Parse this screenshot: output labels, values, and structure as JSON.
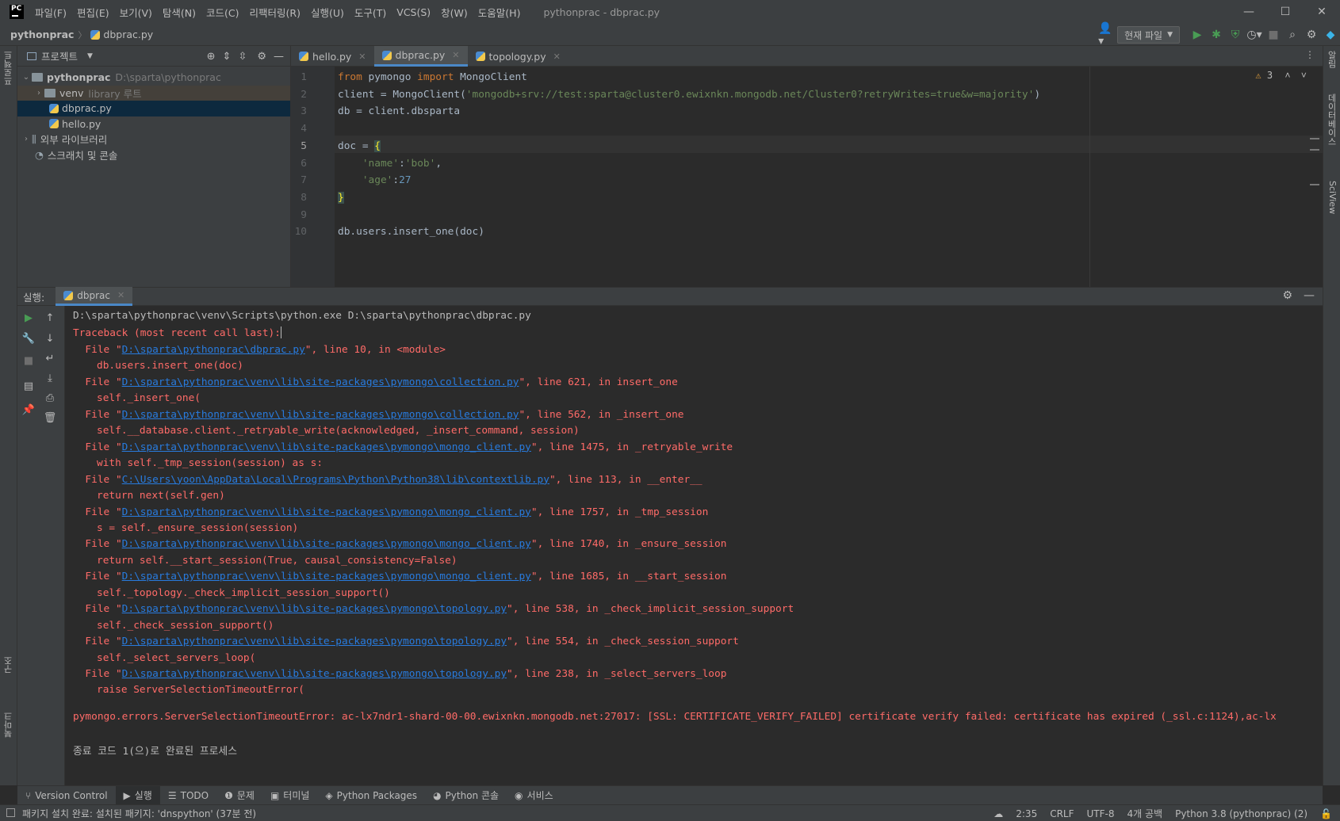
{
  "menu": [
    "파일(F)",
    "편집(E)",
    "보기(V)",
    "탐색(N)",
    "코드(C)",
    "리팩터링(R)",
    "실행(U)",
    "도구(T)",
    "VCS(S)",
    "창(W)",
    "도움말(H)"
  ],
  "window": {
    "title": "pythonprac - dbprac.py",
    "minimize": "—",
    "maximize": "☐",
    "close": "✕"
  },
  "breadcrumb": {
    "project": "pythonprac",
    "file": "dbprac.py"
  },
  "toolbar": {
    "run_config": "현재 파일"
  },
  "left_stripe": {
    "project": "프로젝트",
    "structure": "구조",
    "bookmarks": "북마크"
  },
  "right_stripe": {
    "notifications": "알림",
    "database": "데이터베이스",
    "sciview": "SciView"
  },
  "project_panel": {
    "title": "프로젝트",
    "tree": [
      {
        "label": "pythonprac",
        "sub": "D:\\sparta\\pythonprac"
      },
      {
        "label": "venv",
        "sub": "library 루트"
      },
      {
        "label": "dbprac.py"
      },
      {
        "label": "hello.py"
      },
      {
        "label": "외부 라이브러리"
      },
      {
        "label": "스크래치 및 콘솔"
      }
    ]
  },
  "tabs": [
    "hello.py",
    "dbprac.py",
    "topology.py"
  ],
  "editor": {
    "line_numbers": [
      "1",
      "2",
      "3",
      "4",
      "5",
      "6",
      "7",
      "8",
      "9",
      "10"
    ],
    "warnings": "3",
    "code": {
      "l1_kw1": "from",
      "l1_mod": " pymongo ",
      "l1_kw2": "import",
      "l1_name": " MongoClient",
      "l2_pre": "client = MongoClient(",
      "l2_str": "'mongodb+srv://test:sparta@cluster0.ewixnkn.mongodb.net/Cluster0?retryWrites=true&w=majority'",
      "l2_post": ")",
      "l3": "db = client.dbsparta",
      "l5_pre": "doc = ",
      "l5_brace": "{",
      "l6_key": "'name'",
      "l6_colon": ":",
      "l6_val": "'bob'",
      "l6_comma": ",",
      "l7_key": "'age'",
      "l7_colon": ":",
      "l7_val": "27",
      "l8_brace": "}",
      "l10": "db.users.insert_one(doc)"
    }
  },
  "run": {
    "label": "실행:",
    "tab": "dbprac",
    "console": {
      "cmd": "D:\\sparta\\pythonprac\\venv\\Scripts\\python.exe D:\\sparta\\pythonprac\\dbprac.py",
      "traceback": "Traceback (most recent call last):",
      "frames": [
        {
          "path": "D:\\sparta\\pythonprac\\dbprac.py",
          "rest": "\", line 10, in <module>",
          "code": "db.users.insert_one(doc)"
        },
        {
          "path": "D:\\sparta\\pythonprac\\venv\\lib\\site-packages\\pymongo\\collection.py",
          "rest": "\", line 621, in insert_one",
          "code": "self._insert_one("
        },
        {
          "path": "D:\\sparta\\pythonprac\\venv\\lib\\site-packages\\pymongo\\collection.py",
          "rest": "\", line 562, in _insert_one",
          "code": "self.__database.client._retryable_write(acknowledged, _insert_command, session)"
        },
        {
          "path": "D:\\sparta\\pythonprac\\venv\\lib\\site-packages\\pymongo\\mongo_client.py",
          "rest": "\", line 1475, in _retryable_write",
          "code": "with self._tmp_session(session) as s:"
        },
        {
          "path": "C:\\Users\\yoon\\AppData\\Local\\Programs\\Python\\Python38\\lib\\contextlib.py",
          "rest": "\", line 113, in __enter__",
          "code": "return next(self.gen)"
        },
        {
          "path": "D:\\sparta\\pythonprac\\venv\\lib\\site-packages\\pymongo\\mongo_client.py",
          "rest": "\", line 1757, in _tmp_session",
          "code": "s = self._ensure_session(session)"
        },
        {
          "path": "D:\\sparta\\pythonprac\\venv\\lib\\site-packages\\pymongo\\mongo_client.py",
          "rest": "\", line 1740, in _ensure_session",
          "code": "return self.__start_session(True, causal_consistency=False)"
        },
        {
          "path": "D:\\sparta\\pythonprac\\venv\\lib\\site-packages\\pymongo\\mongo_client.py",
          "rest": "\", line 1685, in __start_session",
          "code": "self._topology._check_implicit_session_support()"
        },
        {
          "path": "D:\\sparta\\pythonprac\\venv\\lib\\site-packages\\pymongo\\topology.py",
          "rest": "\", line 538, in _check_implicit_session_support",
          "code": "self._check_session_support()"
        },
        {
          "path": "D:\\sparta\\pythonprac\\venv\\lib\\site-packages\\pymongo\\topology.py",
          "rest": "\", line 554, in _check_session_support",
          "code": "self._select_servers_loop("
        },
        {
          "path": "D:\\sparta\\pythonprac\\venv\\lib\\site-packages\\pymongo\\topology.py",
          "rest": "\", line 238, in _select_servers_loop",
          "code": "raise ServerSelectionTimeoutError("
        }
      ],
      "file_prefix": "File \"",
      "error": "pymongo.errors.ServerSelectionTimeoutError: ac-lx7ndr1-shard-00-00.ewixnkn.mongodb.net:27017: [SSL: CERTIFICATE_VERIFY_FAILED] certificate verify failed: certificate has expired (_ssl.c:1124),ac-lx",
      "exit": "종료 코드 1(으)로 완료된 프로세스"
    }
  },
  "tool_windows": [
    "Version Control",
    "실행",
    "TODO",
    "문제",
    "터미널",
    "Python Packages",
    "Python 콘솔",
    "서비스"
  ],
  "status": {
    "message": "패키지 설치 완료: 설치된 패키지: 'dnspython' (37분 전)",
    "position": "2:35",
    "line_sep": "CRLF",
    "encoding": "UTF-8",
    "indent": "4개 공백",
    "interpreter": "Python 3.8 (pythonprac) (2)"
  },
  "colors": {
    "accent": "#4a88c7",
    "error": "#ff6b68",
    "link": "#287bde",
    "keyword": "#cc7832",
    "string": "#6a8759",
    "number": "#6897bb"
  }
}
